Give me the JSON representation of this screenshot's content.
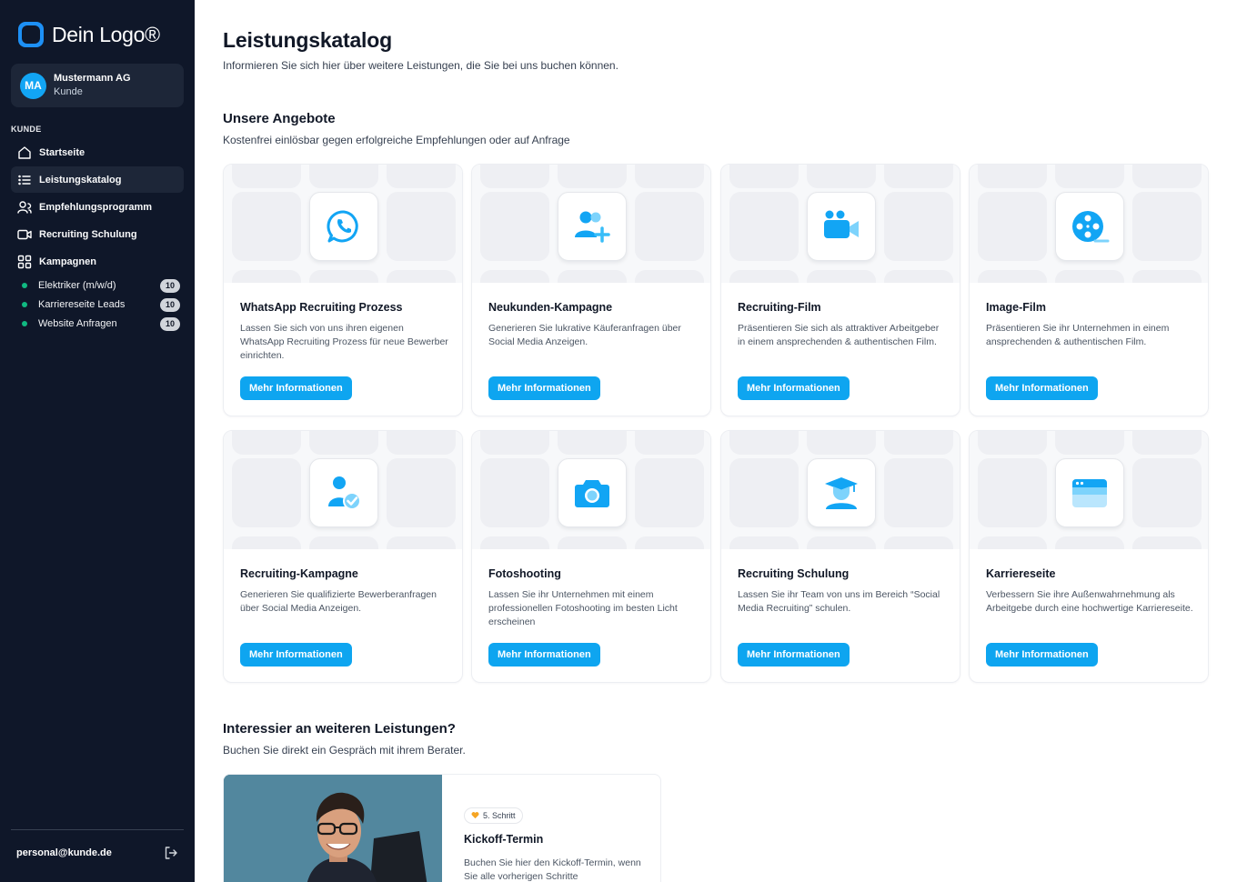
{
  "sidebar": {
    "logo_text": "Dein Logo®",
    "account": {
      "initials": "MA",
      "name": "Mustermann AG",
      "role": "Kunde"
    },
    "section_label": "KUNDE",
    "nav": [
      {
        "label": "Startseite",
        "icon": "home-icon"
      },
      {
        "label": "Leistungskatalog",
        "icon": "list-icon",
        "active": true
      },
      {
        "label": "Empfehlungsprogramm",
        "icon": "users-icon"
      },
      {
        "label": "Recruiting Schulung",
        "icon": "video-icon"
      },
      {
        "label": "Kampagnen",
        "icon": "grid-icon"
      }
    ],
    "campaigns": [
      {
        "label": "Elektriker (m/w/d)",
        "count": "10"
      },
      {
        "label": "Karriereseite Leads",
        "count": "10"
      },
      {
        "label": "Website Anfragen",
        "count": "10"
      }
    ],
    "email": "personal@kunde.de"
  },
  "main": {
    "title": "Leistungskatalog",
    "subtitle": "Informieren Sie sich hier über weitere Leistungen, die Sie bei uns buchen können.",
    "offers_title": "Unsere Angebote",
    "offers_subtitle": "Kostenfrei einlösbar gegen erfolgreiche Empfehlungen oder auf Anfrage",
    "button_label": "Mehr Informationen",
    "cards": [
      {
        "title": "WhatsApp Recruiting Prozess",
        "desc": "Lassen Sie sich von uns ihren eigenen WhatsApp Recruiting Prozess für neue Bewerber einrichten.",
        "icon": "whatsapp-icon"
      },
      {
        "title": "Neukunden-Kampagne",
        "desc": "Generieren Sie lukrative Käuferanfragen über Social Media Anzeigen.",
        "icon": "user-add-icon"
      },
      {
        "title": "Recruiting-Film",
        "desc": "Präsentieren Sie sich als attraktiver Arbeitgeber in einem ansprechenden & authentischen Film.",
        "icon": "video-camera-icon"
      },
      {
        "title": "Image-Film",
        "desc": "Präsentieren Sie ihr Unternehmen in einem ansprechenden & authentischen Film.",
        "icon": "film-reel-icon"
      },
      {
        "title": "Recruiting-Kampagne",
        "desc": "Generieren Sie qualifizierte Bewerberanfragen über Social Media Anzeigen.",
        "icon": "user-check-icon"
      },
      {
        "title": "Fotoshooting",
        "desc": "Lassen Sie ihr Unternehmen mit einem professionellen Fotoshooting im besten Licht erscheinen",
        "icon": "camera-icon"
      },
      {
        "title": "Recruiting Schulung",
        "desc": "Lassen Sie ihr Team von uns im Bereich “Social Media Recruiting” schulen.",
        "icon": "graduate-icon"
      },
      {
        "title": "Karriereseite",
        "desc": "Verbessern Sie ihre Außenwahrnehmung als Arbeitgebe durch eine hochwertige Karriereseite.",
        "icon": "browser-window-icon"
      }
    ],
    "more_title": "Interessier an weiteren Leistungen?",
    "more_subtitle": "Buchen Sie direkt ein Gespräch mit ihrem Berater.",
    "promo": {
      "badge": "5. Schritt",
      "title": "Kickoff-Termin",
      "desc": "Buchen Sie hier den Kickoff-Termin, wenn Sie alle vorherigen Schritte"
    }
  },
  "colors": {
    "sidebar_bg": "#0f1729",
    "accent": "#0ea5f0",
    "status_green": "#10b981"
  }
}
